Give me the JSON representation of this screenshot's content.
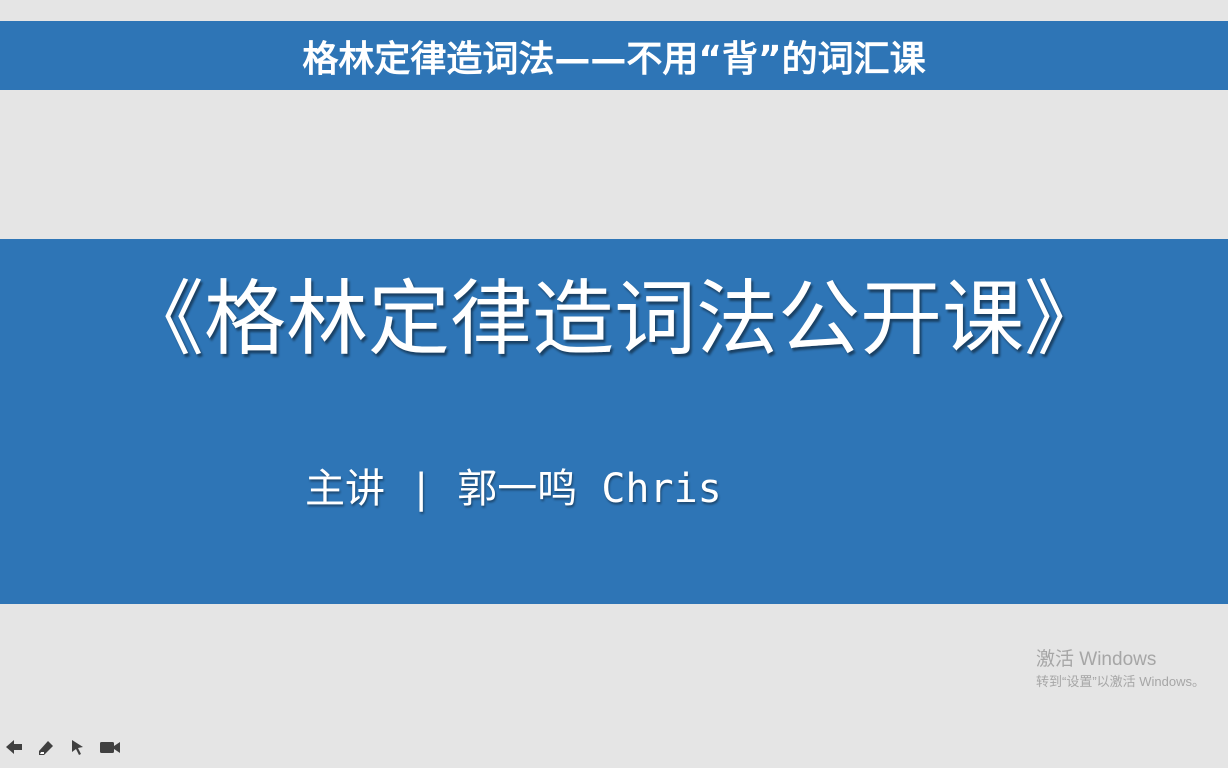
{
  "header": {
    "title": "格林定律造词法——不用“背”的词汇课"
  },
  "slide": {
    "title": "《格林定律造词法公开课》",
    "presenter": "主讲 | 郭一鸣 Chris"
  },
  "watermark": {
    "line1": "激活 Windows",
    "line2": "转到“设置”以激活 Windows。"
  },
  "toolbar": {
    "icons": [
      "previous-arrow-icon",
      "pen-eraser-icon",
      "pointer-icon",
      "camera-icon"
    ]
  },
  "colors": {
    "banner": "#2e75b6",
    "background": "#e5e5e5",
    "text": "#ffffff",
    "watermark": "#a6a6a6",
    "toolbar_icon": "#404040"
  }
}
